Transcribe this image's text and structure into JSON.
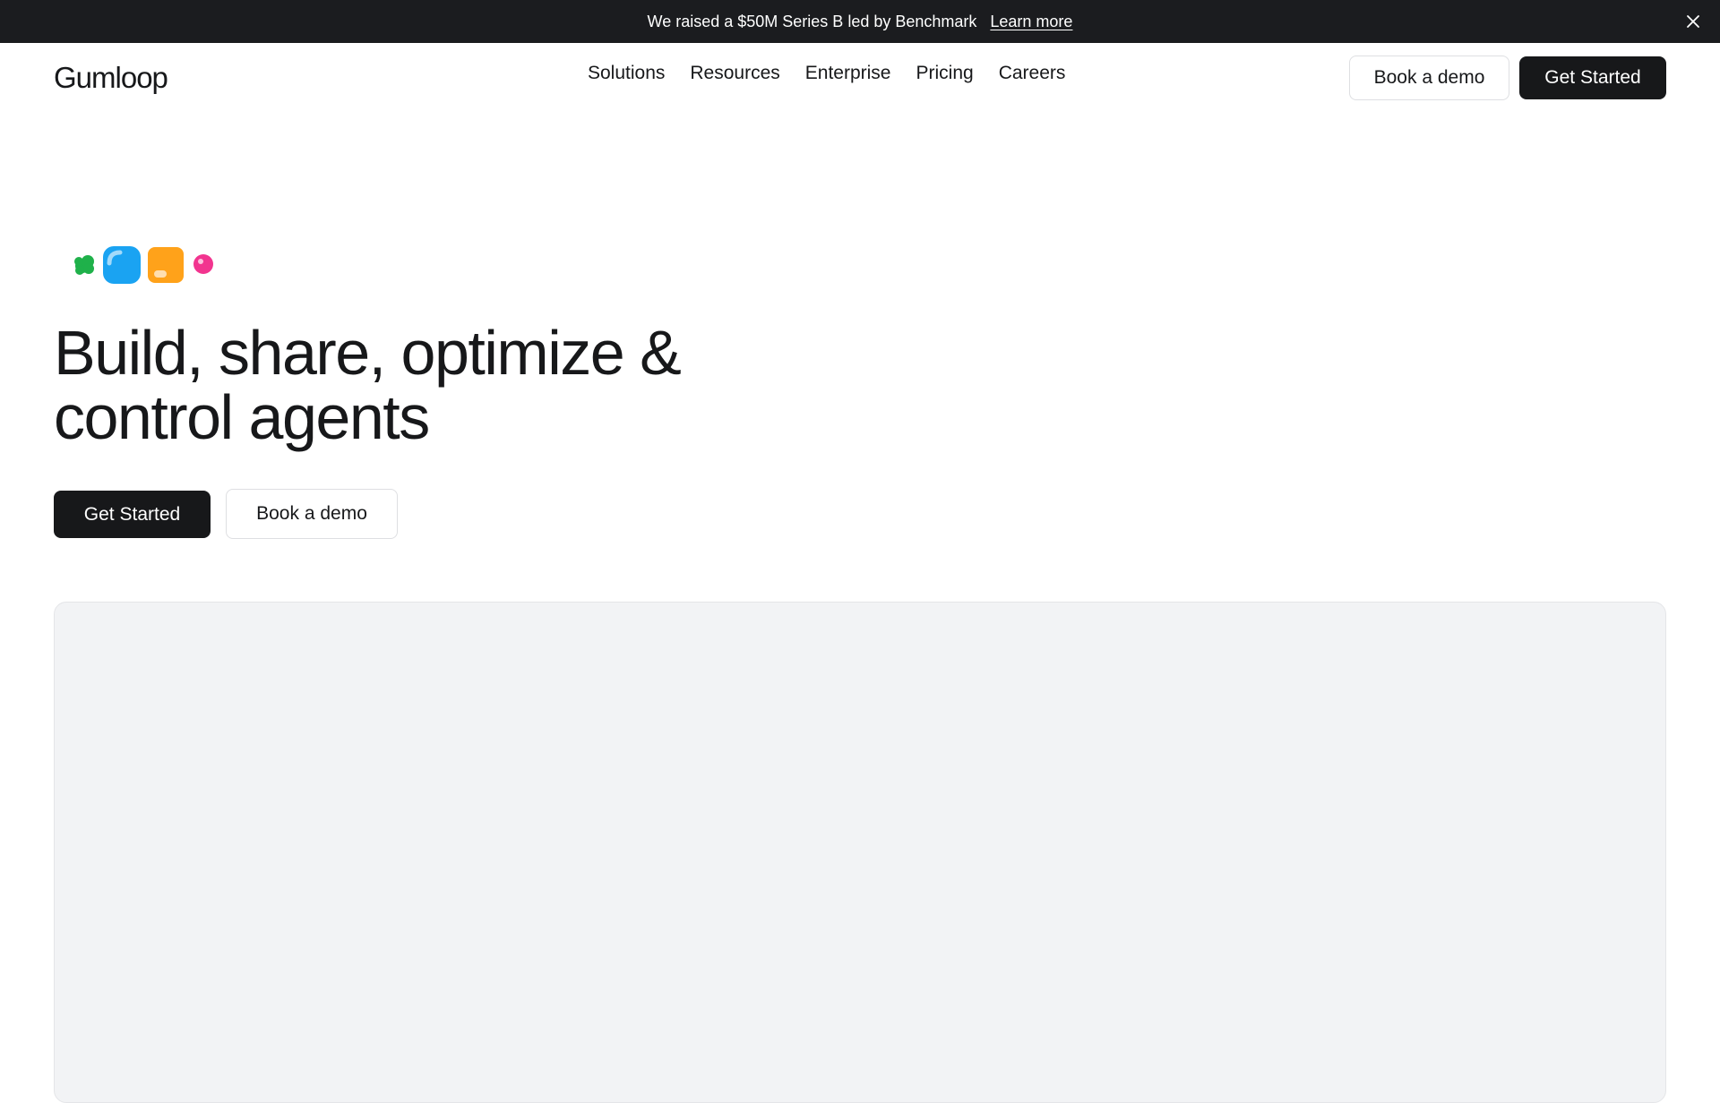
{
  "announcement": {
    "message": "We raised a $50M Series B led by Benchmark",
    "link_label": "Learn more"
  },
  "header": {
    "logo": "Gumloop",
    "nav": [
      "Solutions",
      "Resources",
      "Enterprise",
      "Pricing",
      "Careers"
    ],
    "book_demo_label": "Book a demo",
    "get_started_label": "Get Started"
  },
  "hero": {
    "title_line1": "Build, share, optimize &",
    "title_line2": "control agents",
    "get_started_label": "Get Started",
    "book_demo_label": "Book a demo"
  },
  "colors": {
    "dark": "#17181a",
    "blob_green": "#1fb14a",
    "blob_blue": "#1aa3f2",
    "blob_orange": "#ffa21a",
    "blob_pink": "#f2348f",
    "preview_bg": "#f2f3f5"
  }
}
